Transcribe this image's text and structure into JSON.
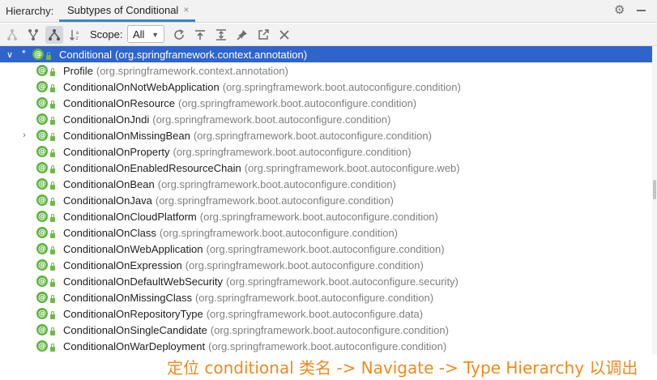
{
  "header": {
    "label": "Hierarchy:",
    "tab_title": "Subtypes of Conditional",
    "tab_close": "×"
  },
  "toolbar": {
    "buttons": [
      "supertypes-icon",
      "subtypes-icon",
      "class-hierarchy-icon",
      "sort-alphabetically-icon",
      "refresh-icon",
      "export-icon",
      "expand-all-icon",
      "pin-icon",
      "open-in-new-icon",
      "close-icon"
    ],
    "scope_label": "Scope:",
    "scope_value": "All"
  },
  "colors": {
    "selection": "#2f65ca",
    "annotation_icon": "#62b543",
    "package_text": "#7f7f7f",
    "caption": "#f2891b"
  },
  "tree": {
    "root": {
      "name": "Conditional",
      "package": "(org.springframework.context.annotation)",
      "star": "*"
    },
    "children": [
      {
        "name": "Profile",
        "package": "(org.springframework.context.annotation)"
      },
      {
        "name": "ConditionalOnNotWebApplication",
        "package": "(org.springframework.boot.autoconfigure.condition)"
      },
      {
        "name": "ConditionalOnResource",
        "package": "(org.springframework.boot.autoconfigure.condition)"
      },
      {
        "name": "ConditionalOnJndi",
        "package": "(org.springframework.boot.autoconfigure.condition)"
      },
      {
        "name": "ConditionalOnMissingBean",
        "package": "(org.springframework.boot.autoconfigure.condition)"
      },
      {
        "name": "ConditionalOnProperty",
        "package": "(org.springframework.boot.autoconfigure.condition)"
      },
      {
        "name": "ConditionalOnEnabledResourceChain",
        "package": "(org.springframework.boot.autoconfigure.web)"
      },
      {
        "name": "ConditionalOnBean",
        "package": "(org.springframework.boot.autoconfigure.condition)"
      },
      {
        "name": "ConditionalOnJava",
        "package": "(org.springframework.boot.autoconfigure.condition)"
      },
      {
        "name": "ConditionalOnCloudPlatform",
        "package": "(org.springframework.boot.autoconfigure.condition)"
      },
      {
        "name": "ConditionalOnClass",
        "package": "(org.springframework.boot.autoconfigure.condition)"
      },
      {
        "name": "ConditionalOnWebApplication",
        "package": "(org.springframework.boot.autoconfigure.condition)"
      },
      {
        "name": "ConditionalOnExpression",
        "package": "(org.springframework.boot.autoconfigure.condition)"
      },
      {
        "name": "ConditionalOnDefaultWebSecurity",
        "package": "(org.springframework.boot.autoconfigure.security)"
      },
      {
        "name": "ConditionalOnMissingClass",
        "package": "(org.springframework.boot.autoconfigure.condition)"
      },
      {
        "name": "ConditionalOnRepositoryType",
        "package": "(org.springframework.boot.autoconfigure.data)"
      },
      {
        "name": "ConditionalOnSingleCandidate",
        "package": "(org.springframework.boot.autoconfigure.condition)"
      },
      {
        "name": "ConditionalOnWarDeployment",
        "package": "(org.springframework.boot.autoconfigure.condition)"
      }
    ]
  },
  "caption": "定位 conditional 类名 -> Navigate -> Type Hierarchy 以调出"
}
